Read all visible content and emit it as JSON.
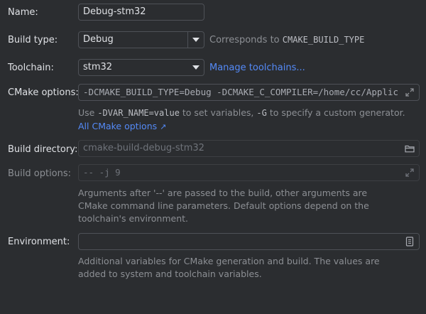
{
  "name": {
    "label": "Name:",
    "value": "Debug-stm32"
  },
  "build_type": {
    "label": "Build type:",
    "value": "Debug",
    "note_prefix": "Corresponds to ",
    "note_code": "CMAKE_BUILD_TYPE"
  },
  "toolchain": {
    "label": "Toolchain:",
    "value": "stm32",
    "manage_link": "Manage toolchains..."
  },
  "cmake_options": {
    "label": "CMake options:",
    "value": "-DCMAKE_BUILD_TYPE=Debug -DCMAKE_C_COMPILER=/home/cc/Applic",
    "help_1": "Use ",
    "help_code_1": "-DVAR_NAME=value",
    "help_2": " to set variables, ",
    "help_code_2": "-G",
    "help_3": " to specify a custom generator.",
    "link": "All CMake options",
    "link_arrow": "↗"
  },
  "build_directory": {
    "label": "Build directory:",
    "value": "cmake-build-debug-stm32"
  },
  "build_options": {
    "label": "Build options:",
    "value": "-- -j 9",
    "help_line_1": "Arguments after '--' are passed to the build, other arguments are",
    "help_line_2": "CMake command line parameters. Default options depend on the",
    "help_line_3": "toolchain's environment."
  },
  "environment": {
    "label": "Environment:",
    "value": "",
    "help_line_1": "Additional variables for CMake generation and build. The values are",
    "help_line_2": "added to system and toolchain variables."
  },
  "icons": [
    "chevron-down-icon",
    "expand-icon",
    "folder-icon",
    "document-icon",
    "external-link-icon"
  ],
  "colors": {
    "background": "#2b2d30",
    "link": "#548af7",
    "border": "#4e5157",
    "hint": "#8c8f94"
  }
}
